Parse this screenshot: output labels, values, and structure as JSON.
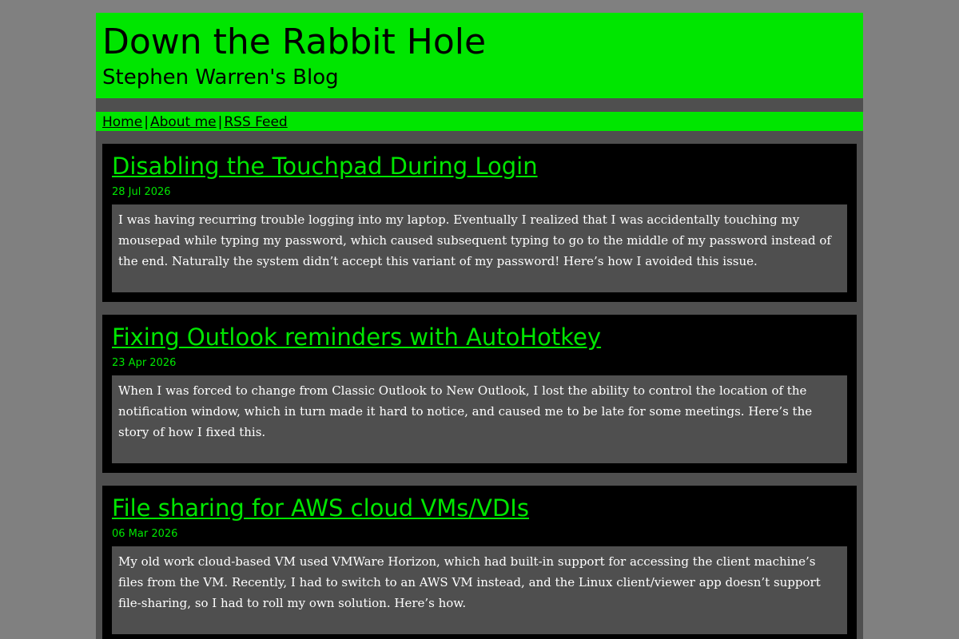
{
  "header": {
    "title": "Down the Rabbit Hole",
    "subtitle": "Stephen Warren's Blog"
  },
  "nav": {
    "items": [
      {
        "label": "Home"
      },
      {
        "label": "About me"
      },
      {
        "label": "RSS Feed"
      }
    ],
    "separator": "|"
  },
  "posts": [
    {
      "title": "Disabling the Touchpad During Login",
      "date": "28 Jul 2026",
      "excerpt": "I was having recurring trouble logging into my laptop. Eventually I realized that I was accidentally touching my mousepad while typing my password, which caused subsequent typing to go to the middle of my password instead of the end. Naturally the system didn’t accept this variant of my password! Here’s how I avoided this issue."
    },
    {
      "title": "Fixing Outlook reminders with AutoHotkey",
      "date": "23 Apr 2026",
      "excerpt": "When I was forced to change from Classic Outlook to New Outlook, I lost the ability to control the location of the notification window, which in turn made it hard to notice, and caused me to be late for some meetings. Here’s the story of how I fixed this."
    },
    {
      "title": "File sharing for AWS cloud VMs/VDIs",
      "date": "06 Mar 2026",
      "excerpt": "My old work cloud-based VM used VMWare Horizon, which had built-in support for accessing the client machine’s files from the VM. Recently, I had to switch to an AWS VM instead, and the Linux client/viewer app doesn’t support file-sharing, so I had to roll my own solution. Here’s how."
    }
  ]
}
